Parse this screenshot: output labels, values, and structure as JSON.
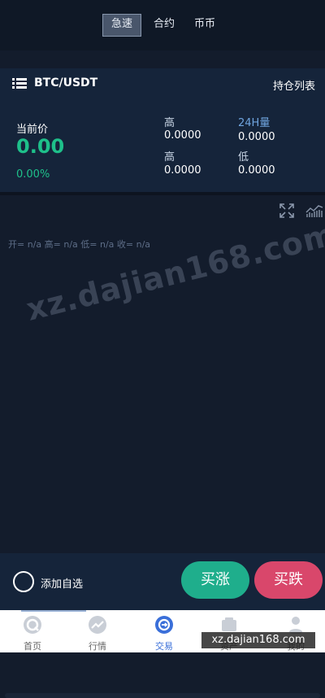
{
  "tabs": [
    "急速",
    "合约",
    "币币"
  ],
  "header": {
    "pair": "BTC/USDT",
    "positions_label": "持仓列表",
    "price_label": "当前价",
    "price": "0.00",
    "change": "0.00%",
    "stats": {
      "high1_label": "高",
      "high1_value": "0.0000",
      "volume_label": "24H量",
      "volume_value": "0.0000",
      "high2_label": "高",
      "high2_value": "0.0000",
      "low_label": "低",
      "low_value": "0.0000"
    }
  },
  "chart": {
    "ohlc": "开= n/a 高= n/a 低= n/a 收= n/a",
    "watermark": "xz.dajian168.com"
  },
  "actions": {
    "favorite_label": "添加自选",
    "buy_label": "买涨",
    "sell_label": "买跌"
  },
  "nav": [
    {
      "label": "首页"
    },
    {
      "label": "行情"
    },
    {
      "label": "交易"
    },
    {
      "label": "资产"
    },
    {
      "label": "我的"
    }
  ],
  "site_badge": "xz.dajian168.com",
  "colors": {
    "up": "#1ec08a",
    "buy": "#1fae8c",
    "sell": "#d9476b",
    "accent": "#3a6fd9"
  }
}
